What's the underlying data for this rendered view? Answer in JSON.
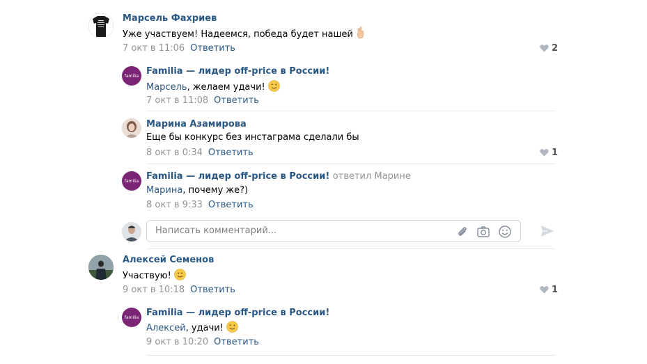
{
  "comments": [
    {
      "author": "Марсель Фахриев",
      "text": "Уже участвуем! Надеемся, победа будет нашей",
      "date": "7 окт в 11:06",
      "reply_label": "Ответить",
      "likes": "2",
      "emoji": "crossed-fingers"
    },
    {
      "author": "Familia — лидер off-price в России!",
      "mention": "Марсель",
      "text": ", желаем удачи!",
      "date": "7 окт в 11:08",
      "reply_label": "Ответить",
      "emoji": "wink"
    },
    {
      "author": "Марина Азамирова",
      "text": "Еще бы конкурс без инстаграма сделали бы",
      "date": "8 окт в 0:34",
      "reply_label": "Ответить",
      "likes": "1"
    },
    {
      "author": "Familia — лидер off-price в России!",
      "replied_to": "ответил Марине",
      "mention": "Марина",
      "text": ", почему же?)",
      "date": "8 окт в 9:33",
      "reply_label": "Ответить"
    },
    {
      "author": "Алексей Семенов",
      "text": "Участвую!",
      "date": "9 окт в 10:18",
      "reply_label": "Ответить",
      "likes": "1",
      "emoji": "smile"
    },
    {
      "author": "Familia — лидер off-price в России!",
      "mention": "Алексей",
      "text": ", удачи!",
      "date": "9 окт в 10:20",
      "reply_label": "Ответить",
      "emoji": "wink"
    }
  ],
  "familia_logo_text": "familia",
  "composer": {
    "placeholder": "Написать комментарий..."
  },
  "colors": {
    "link": "#2a5885",
    "muted": "#939393",
    "brand": "#7b2575"
  }
}
